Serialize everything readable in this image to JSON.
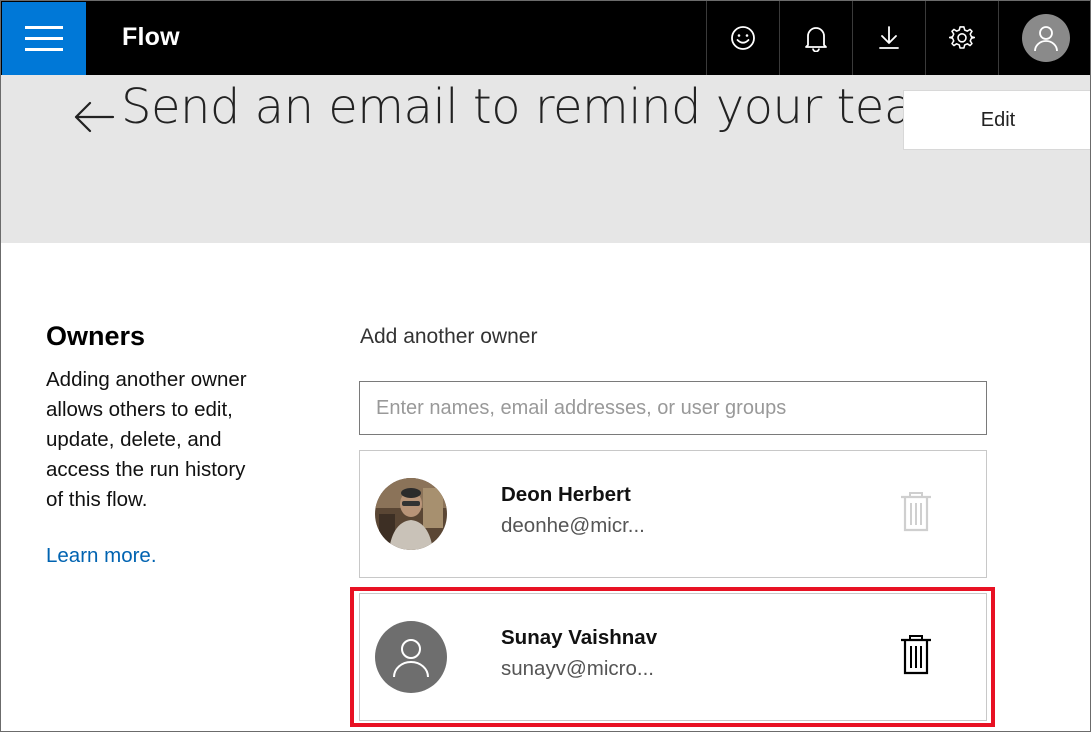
{
  "app": {
    "name": "Flow"
  },
  "topbar": {
    "icons": [
      "smiley-icon",
      "bell-icon",
      "download-icon",
      "gear-icon",
      "user-avatar-icon"
    ]
  },
  "header": {
    "title": "Send an email to remind your tea...",
    "edit_label": "Edit"
  },
  "owners_panel": {
    "heading": "Owners",
    "description": "Adding another owner allows others to edit, update, delete, and access the run history of this flow.",
    "learn_more": "Learn more."
  },
  "add_owner": {
    "label": "Add another owner",
    "placeholder": "Enter names, email addresses, or user groups",
    "value": ""
  },
  "owners": [
    {
      "name": "Deon Herbert",
      "email": "deonhe@micr...",
      "avatar": "photo",
      "delete_enabled": false
    },
    {
      "name": "Sunay Vaishnav",
      "email": "sunayv@micro...",
      "avatar": "generic-person-icon",
      "delete_enabled": true
    }
  ],
  "colors": {
    "accent": "#0078d7",
    "topbar": "#000000",
    "header_band": "#e6e6e6",
    "link": "#0063b1",
    "highlight": "#e81123"
  }
}
